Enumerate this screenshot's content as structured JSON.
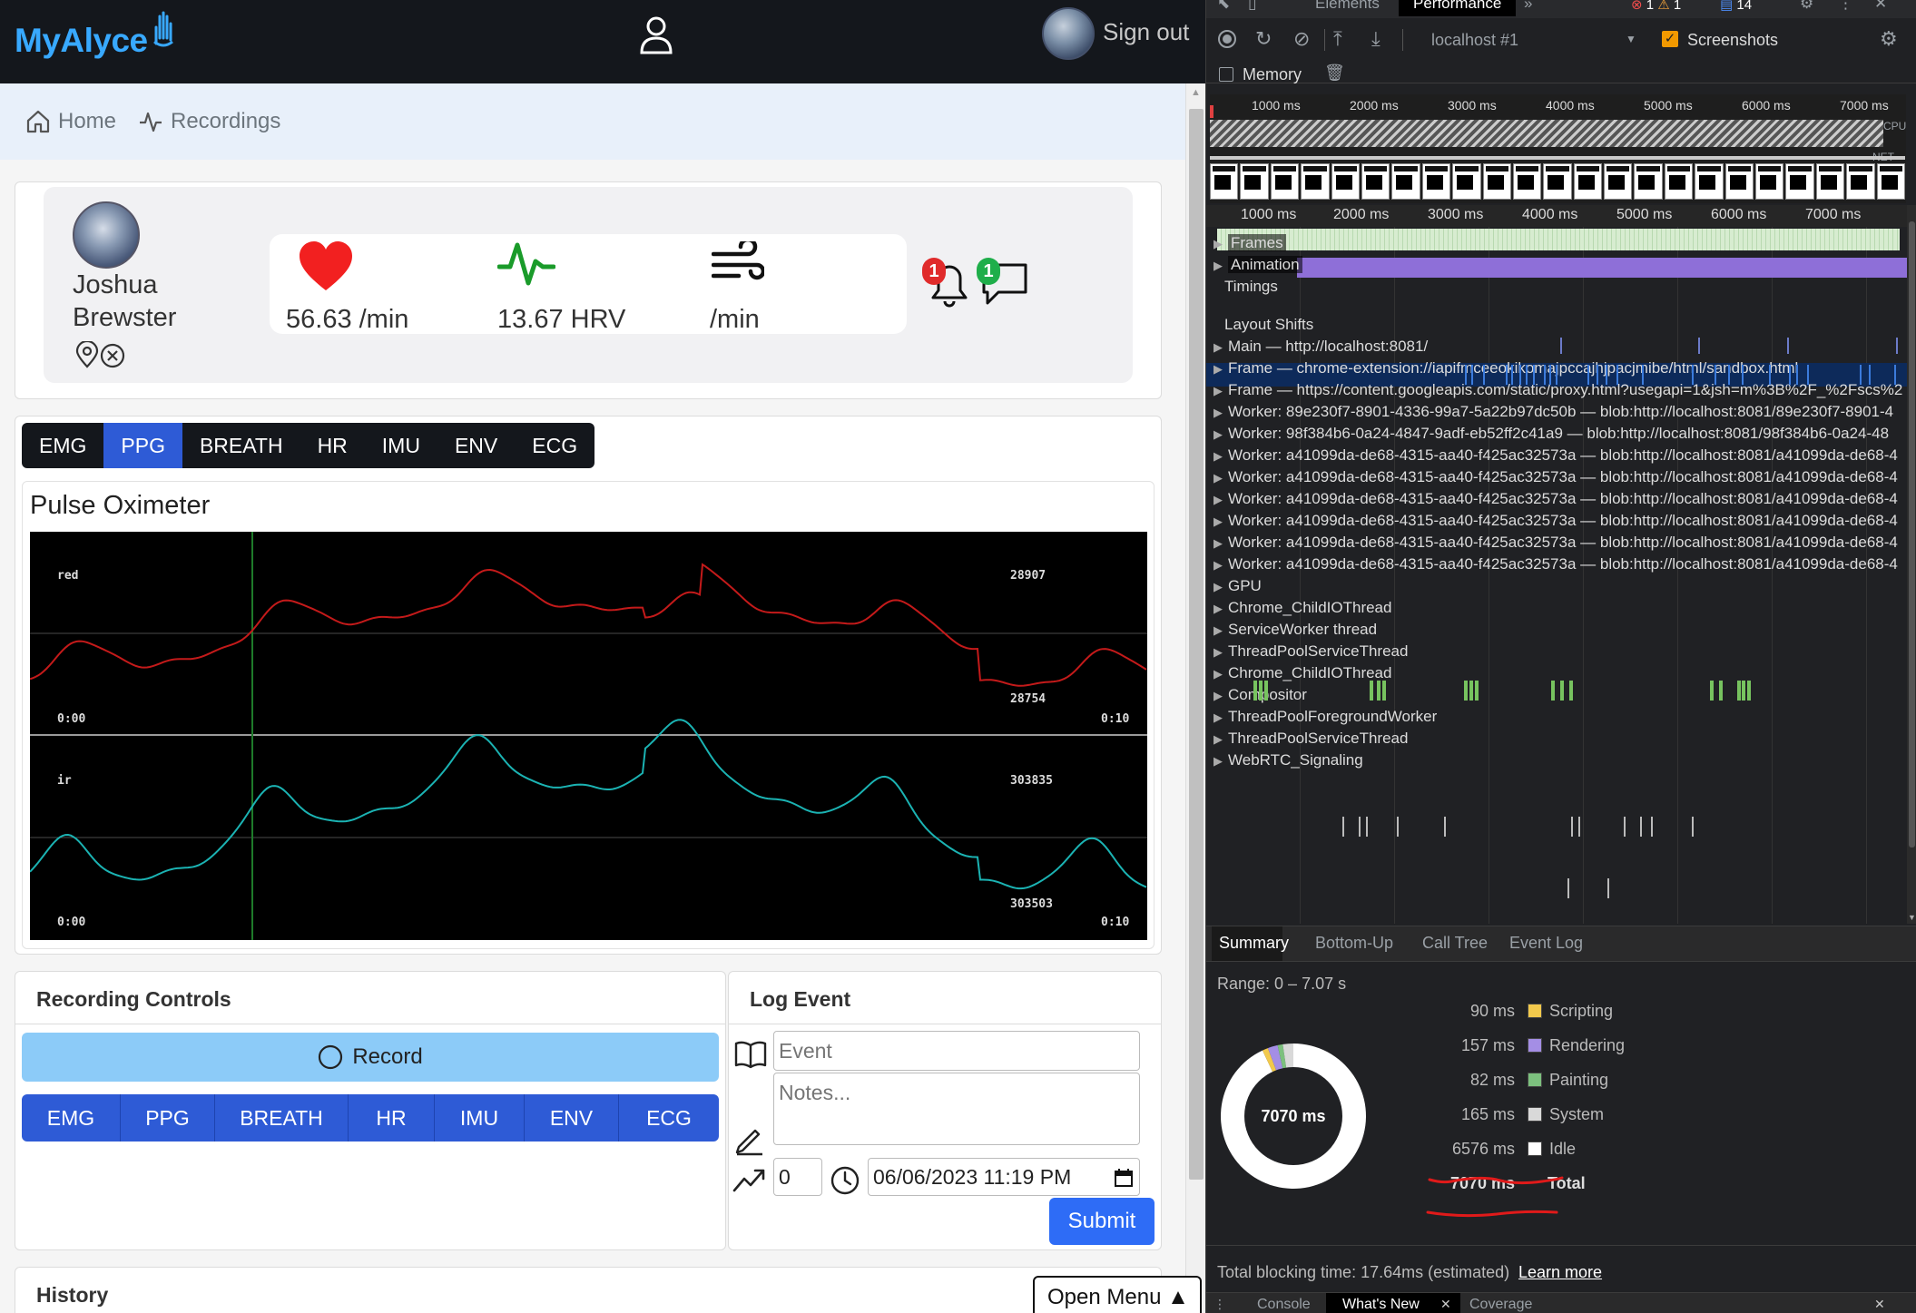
{
  "app": {
    "logo": "MyAlyce",
    "sign_out": "Sign out",
    "breadcrumb": {
      "home": "Home",
      "recordings": "Recordings"
    },
    "patient": {
      "first_name": "Joshua",
      "last_name": "Brewster"
    },
    "vitals": {
      "heart_rate": "56.63 /min",
      "hrv": "13.67 HRV",
      "breath": "/min"
    },
    "notifications": {
      "alerts": "1",
      "messages": "1"
    },
    "tabs": [
      "EMG",
      "PPG",
      "BREATH",
      "HR",
      "IMU",
      "ENV",
      "ECG"
    ],
    "active_tab": "PPG",
    "oximeter": {
      "title": "Pulse Oximeter",
      "red": {
        "label": "red",
        "max": "28907",
        "min": "28754",
        "t_start": "0:00",
        "t_end": "0:10"
      },
      "ir": {
        "label": "ir",
        "max": "303835",
        "min": "303503",
        "t_start": "0:00",
        "t_end": "0:10"
      }
    },
    "recording_controls": {
      "title": "Recording Controls",
      "record_label": "Record",
      "streams": [
        "EMG",
        "PPG",
        "BREATH",
        "HR",
        "IMU",
        "ENV",
        "ECG"
      ]
    },
    "log_event": {
      "title": "Log Event",
      "event_placeholder": "Event",
      "notes_placeholder": "Notes...",
      "value": "0",
      "datetime": "06/06/2023 11:19 PM",
      "submit": "Submit"
    },
    "history_title": "History",
    "open_menu": "Open Menu ▲"
  },
  "devtools": {
    "tabs": [
      "Elements",
      "Performance"
    ],
    "active_tab": "Performance",
    "badges": {
      "errors": "1",
      "warnings": "1",
      "messages": "14"
    },
    "target": "localhost #1",
    "screenshots_label": "Screenshots",
    "memory_label": "Memory",
    "ruler_top": [
      "1000 ms",
      "2000 ms",
      "3000 ms",
      "4000 ms",
      "5000 ms",
      "6000 ms",
      "7000 ms"
    ],
    "ruler_main": [
      "1000 ms",
      "2000 ms",
      "3000 ms",
      "4000 ms",
      "5000 ms",
      "6000 ms",
      "7000 ms"
    ],
    "cpu_label": "CPU",
    "net_label": "NET",
    "tracks": [
      "Frames",
      "Animation",
      "Timings",
      "Layout Shifts",
      "Main — http://localhost:8081/",
      "Frame — chrome-extension://iapifmceeokikomajpccajhjpacjmibe/html/sandbox.html",
      "Frame — https://content.googleapis.com/static/proxy.html?usegapi=1&jsh=m%3B%2F_%2Fscs%2",
      "Worker: 89e230f7-8901-4336-99a7-5a22b97dc50b — blob:http://localhost:8081/89e230f7-8901-4",
      "Worker: 98f384b6-0a24-4847-9adf-eb52ff2c41a9 — blob:http://localhost:8081/98f384b6-0a24-48",
      "Worker: a41099da-de68-4315-aa40-f425ac32573a — blob:http://localhost:8081/a41099da-de68-4",
      "Worker: a41099da-de68-4315-aa40-f425ac32573a — blob:http://localhost:8081/a41099da-de68-4",
      "Worker: a41099da-de68-4315-aa40-f425ac32573a — blob:http://localhost:8081/a41099da-de68-4",
      "Worker: a41099da-de68-4315-aa40-f425ac32573a — blob:http://localhost:8081/a41099da-de68-4",
      "Worker: a41099da-de68-4315-aa40-f425ac32573a — blob:http://localhost:8081/a41099da-de68-4",
      "Worker: a41099da-de68-4315-aa40-f425ac32573a — blob:http://localhost:8081/a41099da-de68-4",
      "GPU",
      "Chrome_ChildIOThread",
      "ServiceWorker thread",
      "ThreadPoolServiceThread",
      "Chrome_ChildIOThread",
      "Compositor",
      "ThreadPoolForegroundWorker",
      "ThreadPoolServiceThread",
      "WebRTC_Signaling"
    ],
    "summary_tabs": [
      "Summary",
      "Bottom-Up",
      "Call Tree",
      "Event Log"
    ],
    "range": "Range: 0 – 7.07 s",
    "donut_total": "7070 ms",
    "breakdown": [
      {
        "ms": "90 ms",
        "label": "Scripting",
        "color": "#f2c94c",
        "value": 90
      },
      {
        "ms": "157 ms",
        "label": "Rendering",
        "color": "#a48ee5",
        "value": 157
      },
      {
        "ms": "82 ms",
        "label": "Painting",
        "color": "#7cc07e",
        "value": 82
      },
      {
        "ms": "165 ms",
        "label": "System",
        "color": "#d9d9d9",
        "value": 165
      },
      {
        "ms": "6576 ms",
        "label": "Idle",
        "color": "#ffffff",
        "value": 6576
      }
    ],
    "total": {
      "ms": "7070 ms",
      "label": "Total"
    },
    "blocking_time": "Total blocking time: 17.64ms (estimated)",
    "learn_more": "Learn more",
    "bottom_tabs": [
      "Console",
      "What's New",
      "Coverage"
    ]
  }
}
